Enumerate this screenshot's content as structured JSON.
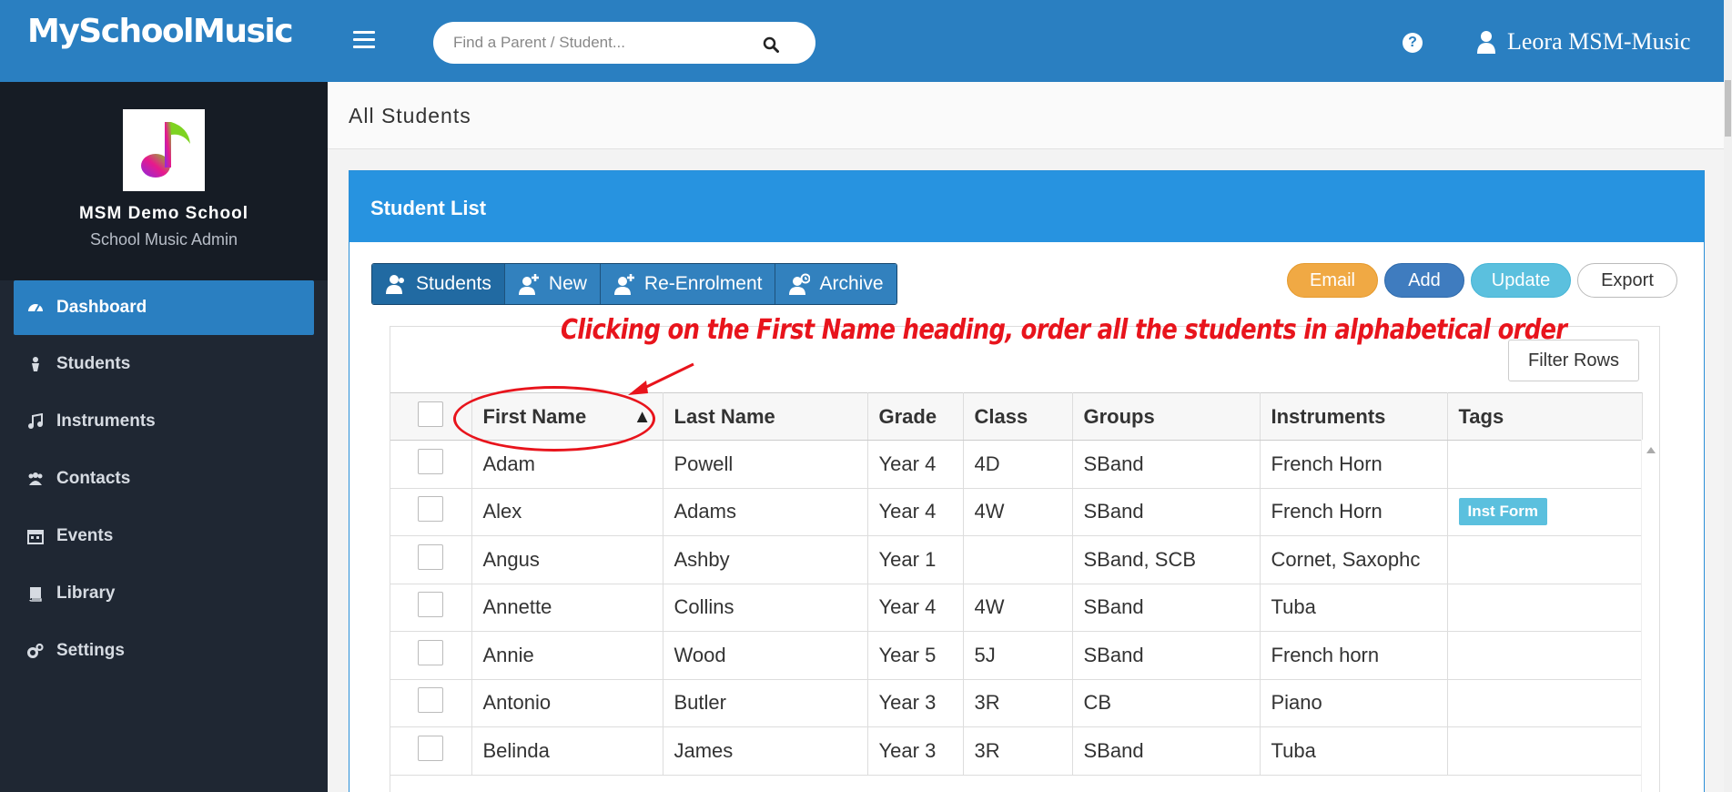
{
  "header": {
    "logo": "MySchoolMusic",
    "search_placeholder": "Find a Parent / Student...",
    "user_name": "Leora MSM-Music"
  },
  "sidebar": {
    "school_name": "MSM Demo School",
    "role": "School Music Admin",
    "items": [
      {
        "label": "Dashboard",
        "icon": "dashboard-icon",
        "active": true
      },
      {
        "label": "Students",
        "icon": "student-icon"
      },
      {
        "label": "Instruments",
        "icon": "music-note-icon"
      },
      {
        "label": "Contacts",
        "icon": "users-icon"
      },
      {
        "label": "Events",
        "icon": "calendar-icon"
      },
      {
        "label": "Library",
        "icon": "book-icon"
      },
      {
        "label": "Settings",
        "icon": "gears-icon"
      }
    ]
  },
  "page": {
    "title": "All Students",
    "panel_title": "Student List"
  },
  "toolbar": {
    "group": [
      "Students",
      "New",
      "Re-Enrolment",
      "Archive"
    ],
    "email": "Email",
    "add": "Add",
    "update": "Update",
    "export": "Export",
    "filter_rows": "Filter Rows"
  },
  "annotation": "Clicking on the First Name heading, order all the students in alphabetical order",
  "table": {
    "columns": [
      "First Name",
      "Last Name",
      "Grade",
      "Class",
      "Groups",
      "Instruments",
      "Tags"
    ],
    "sort_indicator": "▲",
    "rows": [
      [
        "Adam",
        "Powell",
        "Year 4",
        "4D",
        "SBand",
        "French Horn",
        ""
      ],
      [
        "Alex",
        "Adams",
        "Year 4",
        "4W",
        "SBand",
        "French Horn",
        "Inst Form"
      ],
      [
        "Angus",
        "Ashby",
        "Year 1",
        "",
        "SBand, SCB",
        "Cornet, Saxophc",
        ""
      ],
      [
        "Annette",
        "Collins",
        "Year 4",
        "4W",
        "SBand",
        "Tuba",
        ""
      ],
      [
        "Annie",
        "Wood",
        "Year 5",
        "5J",
        "SBand",
        "French horn",
        ""
      ],
      [
        "Antonio",
        "Butler",
        "Year 3",
        "3R",
        "CB",
        "Piano",
        ""
      ],
      [
        "Belinda",
        "James",
        "Year 3",
        "3R",
        "SBand",
        "Tuba",
        ""
      ]
    ]
  },
  "colors": {
    "topbar": "#2a7fc1",
    "sidebar": "#1f2733",
    "panel_header": "#2793e0",
    "annotation": "#e8141c"
  }
}
